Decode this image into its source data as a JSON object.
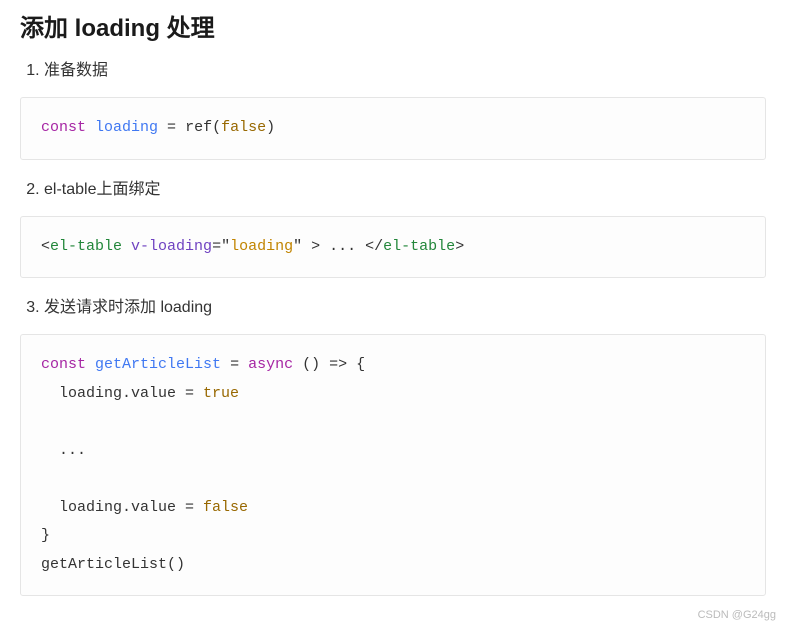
{
  "heading": "添加 loading 处理",
  "steps": {
    "s1": "准备数据",
    "s2": "el-table上面绑定",
    "s3": "发送请求时添加 loading"
  },
  "code1": {
    "kw_const": "const",
    "ident": "loading",
    "eq": " = ",
    "call": "ref",
    "lp": "(",
    "val": "false",
    "rp": ")"
  },
  "code2": {
    "lt1": "<",
    "tag": "el-table",
    "sp": " ",
    "attr": "v-loading",
    "eq": "=",
    "q1": "\"",
    "str": "loading",
    "q2": "\"",
    "gt1": " > ",
    "dots": "...",
    "lt2": " </",
    "tag2": "el-table",
    "gt2": ">"
  },
  "code3": {
    "kw_const": "const",
    "fn": "getArticleList",
    "eq": " = ",
    "kw_async": "async",
    "arrow": " () => {",
    "line_true": "  loading.value = ",
    "true": "true",
    "blank": "",
    "dots": "  ...",
    "line_false": "  loading.value = ",
    "false": "false",
    "close": "}",
    "call": "getArticleList()"
  },
  "watermark": "CSDN @G24gg"
}
